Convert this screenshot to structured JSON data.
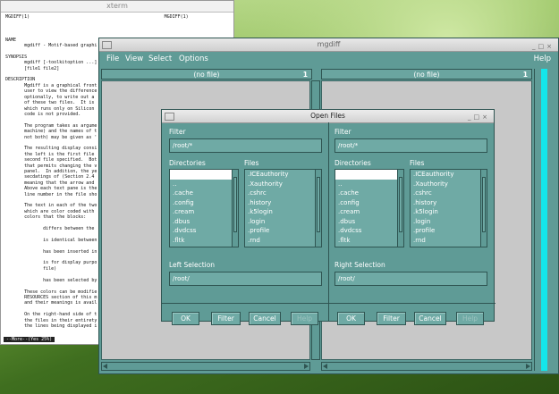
{
  "xterm": {
    "title": "xterm",
    "lines": [
      "MGDIFF(1)                                                  MGDIFF(1)",
      "",
      "",
      "",
      "NAME",
      "       mgdiff - Motif-based graphi",
      "",
      "SYNOPSIS",
      "       mgdiff [-toolkitoption ...]",
      "       [file1 file2]",
      "",
      "DESCRIPTION",
      "       Mgdiff is a graphical front",
      "       user to view the difference",
      "       optionally, to write out a",
      "       of these two files.  It is",
      "       which runs only on Silicon",
      "       code is not provided.",
      "",
      "       The program takes as argume",
      "       machine) and the names of t",
      "       not both) may be given as '",
      "",
      "       The resulting display consi",
      "       the left is the first file",
      "       second file specified.  Bot",
      "       that permits changing the v",
      "       panel.  In addition, the ye",
      "       secdatings of (Section 2.4",
      "       meaning that the arrow and",
      "       Above each text pane is the",
      "       line number in the file sho",
      "",
      "       The text in each of the two",
      "       which are color coded with",
      "       colors that the blocks:",
      "",
      "              differs between the",
      "",
      "              is identical between",
      "",
      "              has been inserted in",
      "",
      "              is for display purpo",
      "              file)",
      "",
      "              has been selected by",
      "",
      "       These colors can be modifie",
      "       RESOURCES section of this m",
      "       and their meanings is avail",
      "",
      "       On the right-hand side of t",
      "       the files in their entirety",
      "       the lines being displayed i"
    ],
    "status": "--More--(Yes 25%)"
  },
  "mgdiff": {
    "title": "mgdiff",
    "menu": [
      "File",
      "View",
      "Select",
      "Options"
    ],
    "help": "Help",
    "left_header": "(no file)",
    "left_num": "1",
    "right_header": "(no file)",
    "right_num": "1"
  },
  "dialog": {
    "title": "Open Files",
    "left": {
      "filter_label": "Filter",
      "filter_value": "/root/*",
      "dirs_label": "Directories",
      "files_label": "Files",
      "dirs": [
        "",
        "..",
        ".cache",
        ".config",
        ".cream",
        ".dbus",
        ".dvdcss",
        ".fltk"
      ],
      "files": [
        ".ICEauthority",
        ".Xauthority",
        ".cshrc",
        ".history",
        ".k5login",
        ".login",
        ".profile",
        ".rnd"
      ],
      "selection_label": "Left Selection",
      "selection_value": "/root/"
    },
    "right": {
      "filter_label": "Filter",
      "filter_value": "/root/*",
      "dirs_label": "Directories",
      "files_label": "Files",
      "dirs": [
        "",
        "..",
        ".cache",
        ".config",
        ".cream",
        ".dbus",
        ".dvdcss",
        ".fltk"
      ],
      "files": [
        ".ICEauthority",
        ".Xauthority",
        ".cshrc",
        ".history",
        ".k5login",
        ".login",
        ".profile",
        ".rnd"
      ],
      "selection_label": "Right Selection",
      "selection_value": "/root/"
    },
    "buttons": [
      "OK",
      "Filter",
      "Cancel",
      "Help"
    ]
  }
}
